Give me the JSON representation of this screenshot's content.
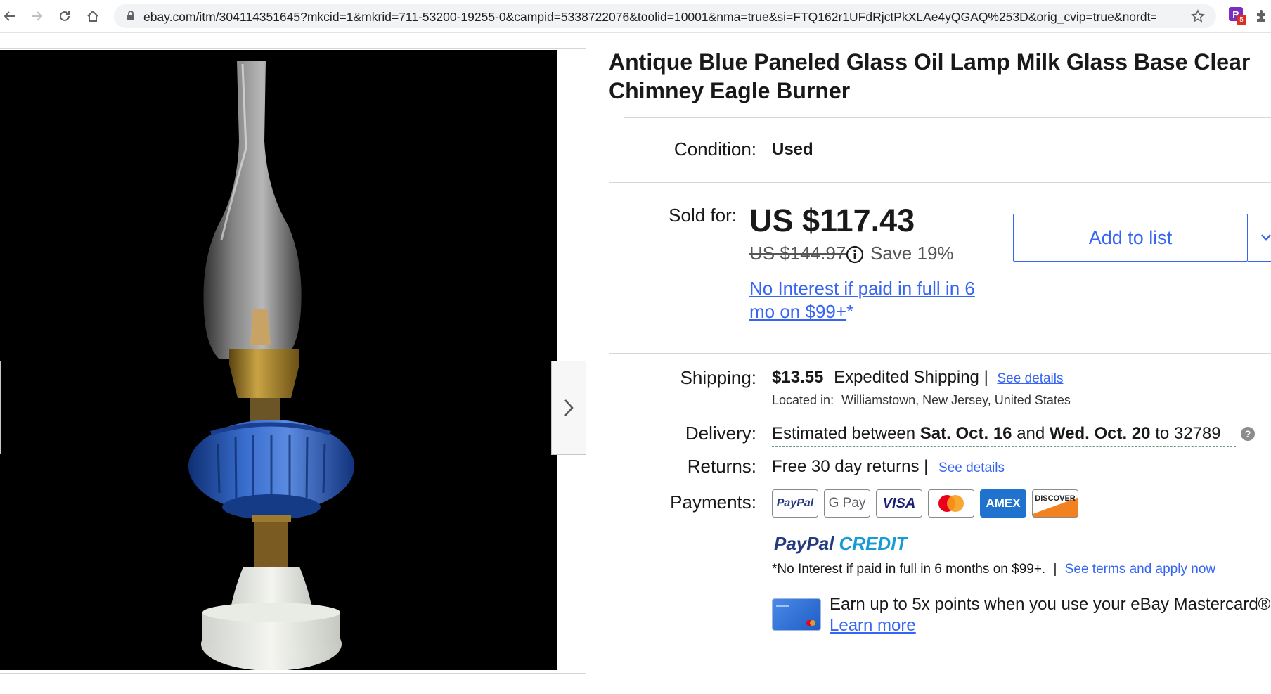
{
  "browser": {
    "url": "ebay.com/itm/304114351645?mkcid=1&mkrid=711-53200-19255-0&campid=5338722076&toolid=10001&nma=true&si=FTQ162r1UFdRjctPkXLAe4yQGAQ%253D&orig_cvip=true&nordt=t...",
    "extension_badge": "5"
  },
  "item": {
    "title": "Antique Blue Paneled Glass Oil Lamp Milk Glass Base Clear Chimney Eagle Burner",
    "condition_label": "Condition:",
    "condition_value": "Used",
    "sold_label": "Sold for:",
    "price": "US $117.43",
    "original_price": "US $144.97",
    "save_text": "Save 19%",
    "credit_offer": "No Interest if paid in full in 6 mo on $99+",
    "credit_asterisk": "*",
    "add_to_list": "Add to list"
  },
  "shipping": {
    "label": "Shipping:",
    "cost": "$13.55",
    "method": "Expedited Shipping |",
    "see_details": "See details",
    "located_label": "Located in:",
    "location": "Williamstown, New Jersey, United States"
  },
  "delivery": {
    "label": "Delivery:",
    "prefix": "Estimated between",
    "start": "Sat. Oct. 16",
    "and": "and",
    "end": "Wed. Oct. 20",
    "to": "to 32789",
    "help": "?"
  },
  "returns": {
    "label": "Returns:",
    "text": "Free 30 day returns |",
    "see_details": "See details"
  },
  "payments": {
    "label": "Payments:",
    "methods": [
      "PayPal",
      "G Pay",
      "VISA",
      "Mastercard",
      "AMEX",
      "DISCOVER"
    ],
    "paypal_credit_1": "PayPal",
    "paypal_credit_2": "CREDIT",
    "note": "*No Interest if paid in full in 6 months on $99+.",
    "separator": "|",
    "terms_link": "See terms and apply now",
    "card_text": "Earn up to 5x points when you use your eBay Mastercard®",
    "learn_more": "Learn more"
  },
  "colors": {
    "link": "#3665f3",
    "lamp_blue": "#1f4fa8",
    "brass": "#b08a2e"
  }
}
